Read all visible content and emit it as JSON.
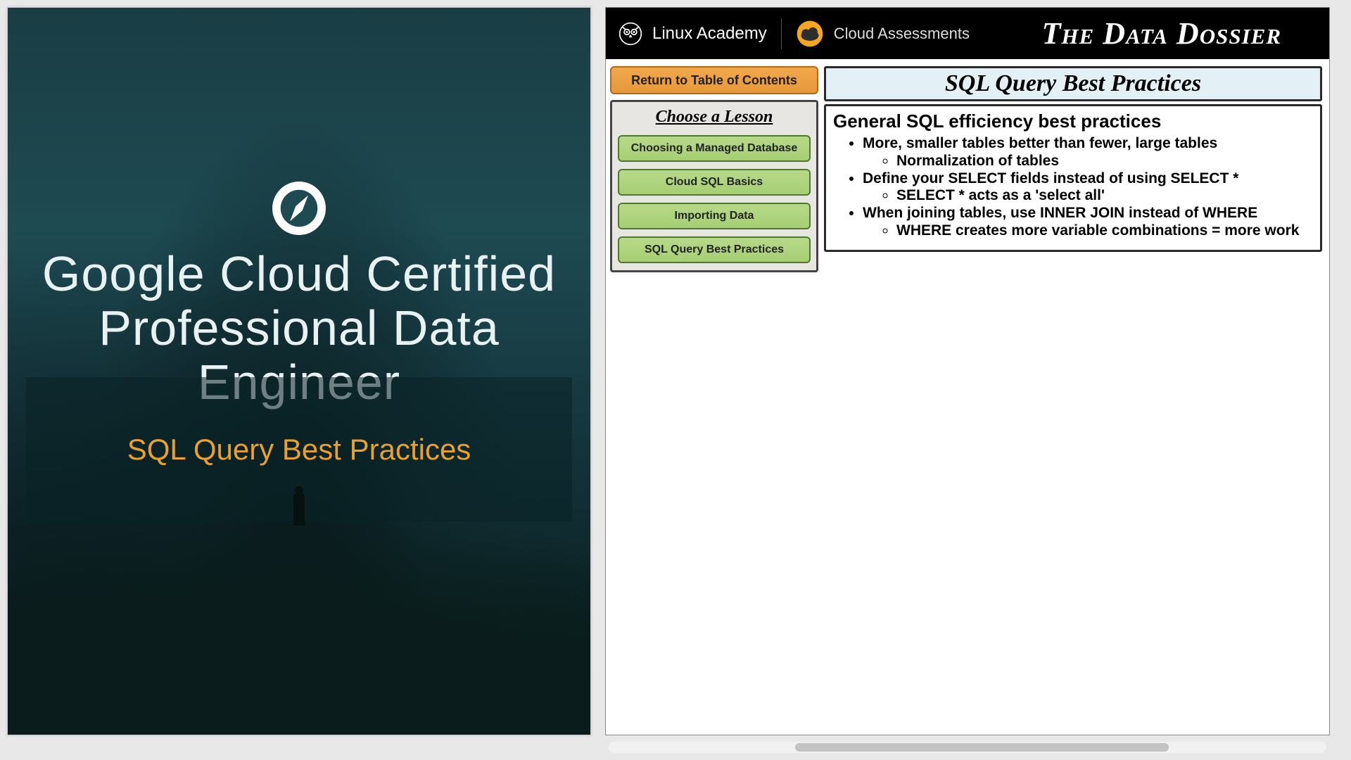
{
  "cover": {
    "title_line1": "Google Cloud Certified",
    "title_line2": "Professional Data Engineer",
    "subtitle": "SQL Query Best Practices"
  },
  "topbar": {
    "linux_academy": "Linux Academy",
    "cloud_assessments": "Cloud Assessments",
    "dossier": "The Data Dossier"
  },
  "sidebar": {
    "toc_label": "Return to Table of Contents",
    "lesson_heading": "Choose a Lesson",
    "lessons": [
      "Choosing a Managed Database",
      "Cloud SQL Basics",
      "Importing Data",
      "SQL Query Best Practices"
    ]
  },
  "content": {
    "title": "SQL Query Best Practices",
    "subheading": "General SQL efficiency best practices",
    "bullets": [
      {
        "text": "More, smaller tables better than fewer, large tables",
        "sub": [
          "Normalization of tables"
        ]
      },
      {
        "text": "Define your SELECT fields instead of using SELECT *",
        "sub": [
          "SELECT * acts as a 'select all'"
        ]
      },
      {
        "text": "When joining tables, use INNER JOIN instead of WHERE",
        "sub": [
          "WHERE creates more variable combinations = more work"
        ]
      }
    ]
  }
}
